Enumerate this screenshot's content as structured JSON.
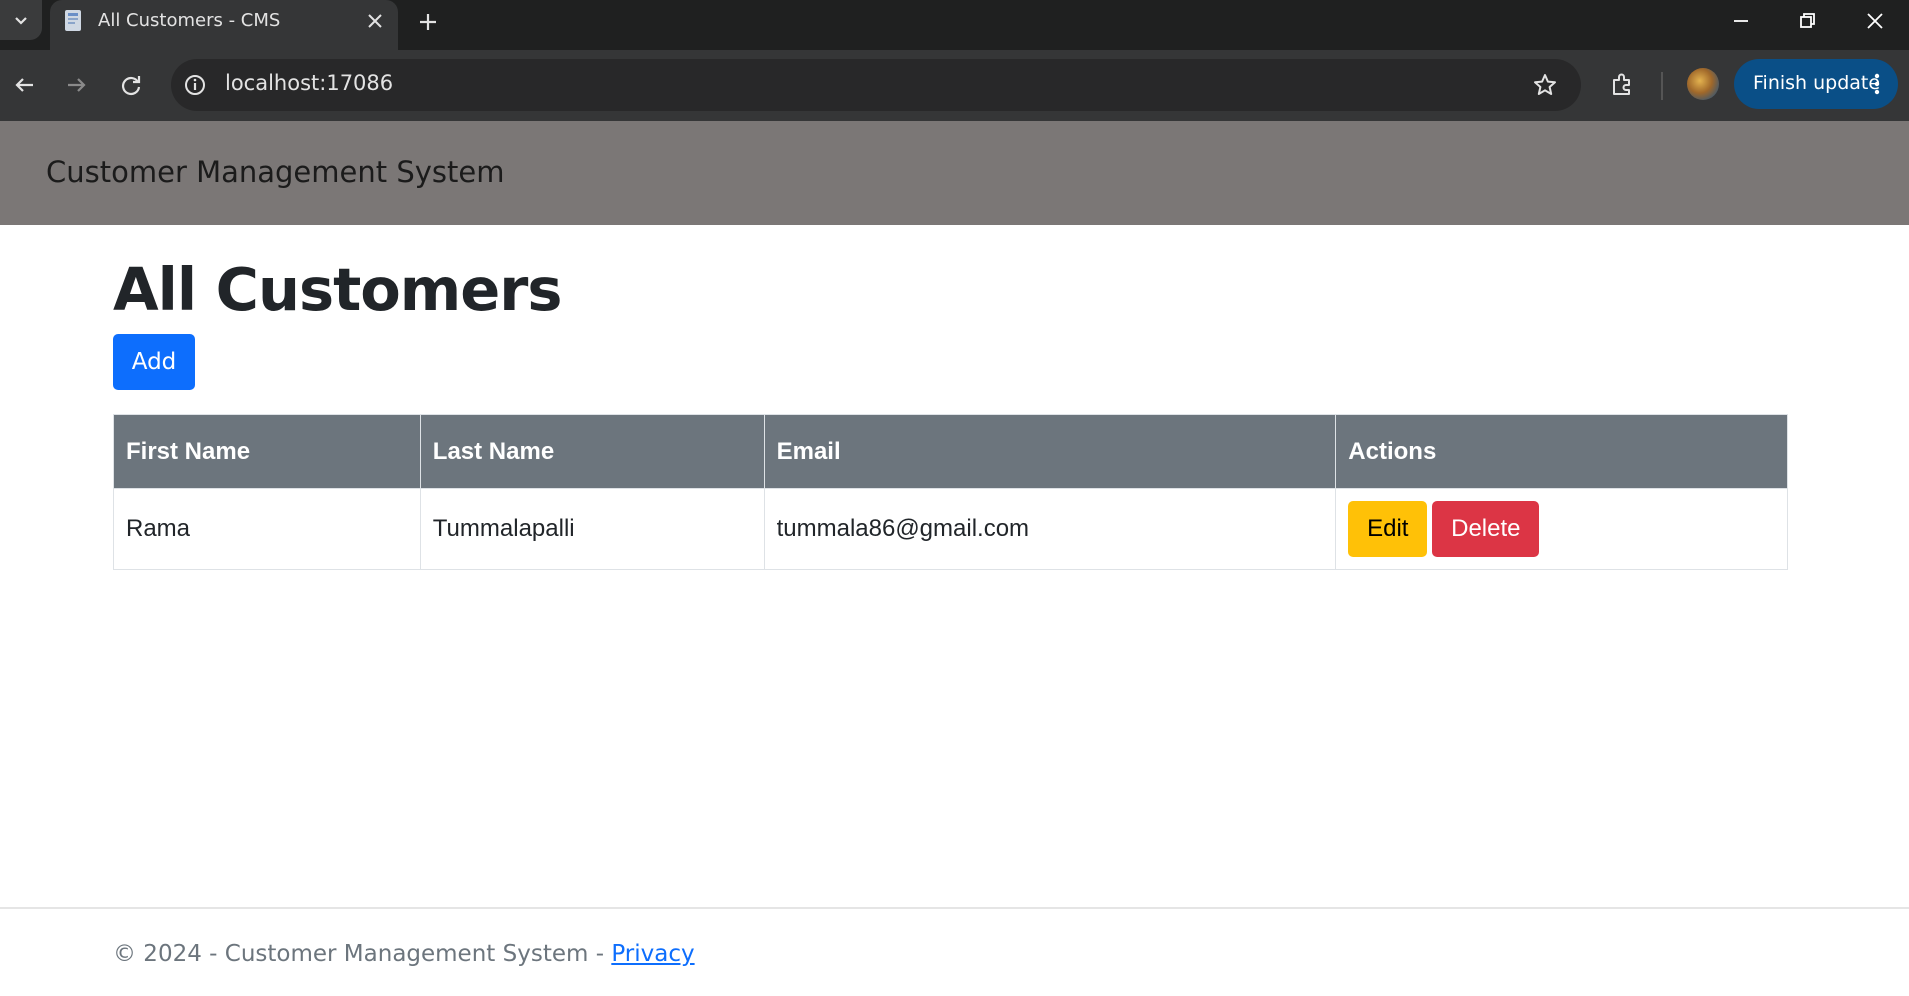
{
  "browser": {
    "tab_title": "All Customers - CMS",
    "url": "localhost:17086",
    "update_label": "Finish update"
  },
  "site": {
    "brand": "Customer Management System"
  },
  "main": {
    "title": "All Customers",
    "add_label": "Add",
    "table": {
      "headers": [
        "First Name",
        "Last Name",
        "Email",
        "Actions"
      ],
      "rows": [
        {
          "first_name": "Rama",
          "last_name": "Tummalapalli",
          "email": "tummala86@gmail.com",
          "edit_label": "Edit",
          "delete_label": "Delete"
        }
      ]
    }
  },
  "footer": {
    "text": "© 2024 - Customer Management System - ",
    "link_label": "Privacy"
  },
  "colors": {
    "primary": "#0d6efd",
    "warning": "#ffc107",
    "danger": "#dc3545",
    "table_header": "#6c757d",
    "site_header": "#7b7776"
  },
  "icons": [
    "tab-search-icon",
    "favicon-icon",
    "close-icon",
    "plus-icon",
    "minimize-icon",
    "restore-icon",
    "window-close-icon",
    "back-icon",
    "forward-icon",
    "reload-icon",
    "info-icon",
    "star-icon",
    "extensions-icon",
    "more-icon"
  ]
}
